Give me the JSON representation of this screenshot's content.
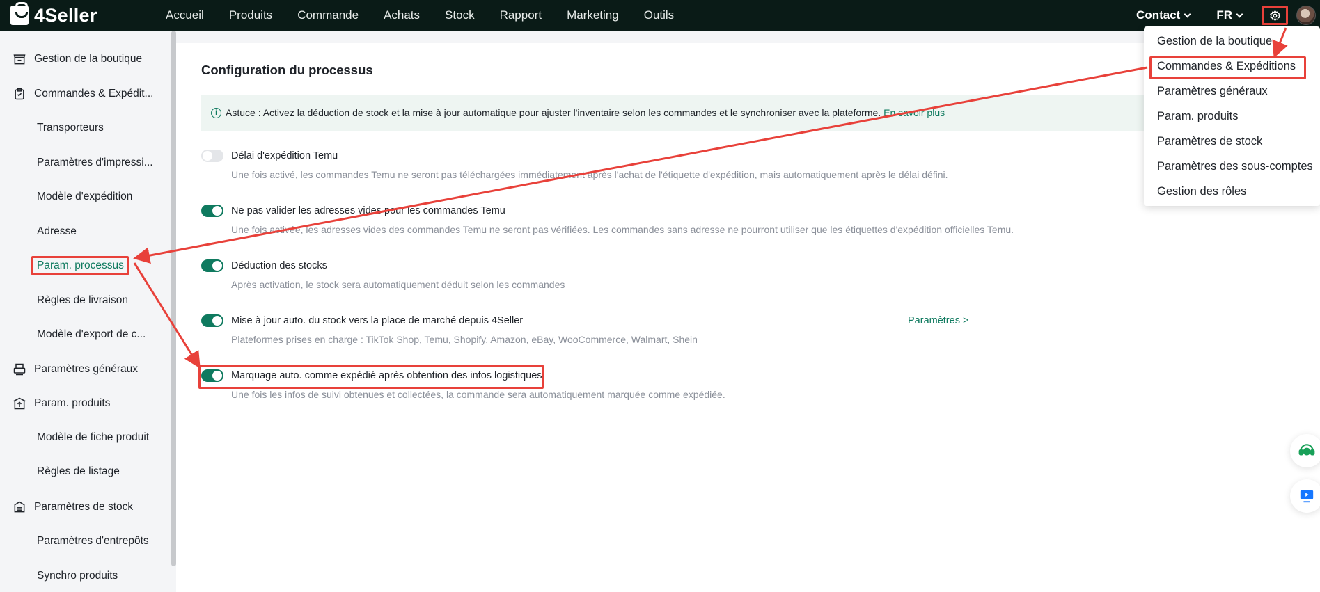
{
  "brand": {
    "name": "4Seller"
  },
  "nav": {
    "items": [
      {
        "label": "Accueil"
      },
      {
        "label": "Produits"
      },
      {
        "label": "Commande"
      },
      {
        "label": "Achats"
      },
      {
        "label": "Stock"
      },
      {
        "label": "Rapport"
      },
      {
        "label": "Marketing"
      },
      {
        "label": "Outils"
      }
    ],
    "contact": "Contact",
    "language": "FR"
  },
  "sidebar": {
    "groups": [
      {
        "label": "Gestion de la boutique",
        "icon": "store-icon"
      },
      {
        "label": "Commandes & Expédit...",
        "icon": "clipboard-icon"
      },
      {
        "label": "Paramètres généraux",
        "icon": "printer-icon"
      },
      {
        "label": "Param. produits",
        "icon": "upload-box-icon"
      },
      {
        "label": "Paramètres de stock",
        "icon": "stock-icon"
      }
    ],
    "items": [
      {
        "label": "Transporteurs"
      },
      {
        "label": "Paramètres d'impressi..."
      },
      {
        "label": "Modèle d'expédition"
      },
      {
        "label": "Adresse"
      },
      {
        "label": "Param. processus"
      },
      {
        "label": "Règles de livraison"
      },
      {
        "label": "Modèle d'export de c..."
      },
      {
        "label": "Modèle de fiche produit"
      },
      {
        "label": "Règles de listage"
      },
      {
        "label": "Paramètres d'entrepôts"
      },
      {
        "label": "Synchro produits"
      }
    ]
  },
  "main": {
    "title": "Configuration du processus",
    "tip": {
      "text": "Astuce : Activez la déduction de stock et la mise à jour automatique pour ajuster l'inventaire selon les commandes et le synchroniser avec la plateforme.",
      "link": "En savoir plus"
    },
    "settings": [
      {
        "label": "Délai d'expédition Temu",
        "enabled": false,
        "desc": "Une fois activé, les commandes Temu ne seront pas téléchargées immédiatement après l'achat de l'étiquette d'expédition, mais automatiquement après le délai défini."
      },
      {
        "label": "Ne pas valider les adresses vides pour les commandes Temu",
        "enabled": true,
        "desc": "Une fois activée, les adresses vides des commandes Temu ne seront pas vérifiées. Les commandes sans adresse ne pourront utiliser que les étiquettes d'expédition officielles Temu."
      },
      {
        "label": "Déduction des stocks",
        "enabled": true,
        "desc": "Après activation, le stock sera automatiquement déduit selon les commandes"
      },
      {
        "label": "Mise à jour auto. du stock vers la place de marché depuis 4Seller",
        "enabled": true,
        "desc": "Plateformes prises en charge : TikTok Shop, Temu, Shopify, Amazon, eBay, WooCommerce, Walmart, Shein",
        "link": "Paramètres >"
      },
      {
        "label": "Marquage auto. comme expédié après obtention des infos logistiques",
        "enabled": true,
        "desc": "Une fois les infos de suivi obtenues et collectées, la commande sera automatiquement marquée comme expédiée."
      }
    ]
  },
  "dropdown": {
    "items": [
      {
        "label": "Gestion de la boutique"
      },
      {
        "label": "Commandes & Expéditions"
      },
      {
        "label": "Paramètres généraux"
      },
      {
        "label": "Param. produits"
      },
      {
        "label": "Paramètres de stock"
      },
      {
        "label": "Paramètres des sous-comptes"
      },
      {
        "label": "Gestion des rôles"
      }
    ]
  },
  "colors": {
    "accent": "#0f7a5f",
    "topbar": "#0a1b17",
    "annotation": "#e8413a"
  }
}
